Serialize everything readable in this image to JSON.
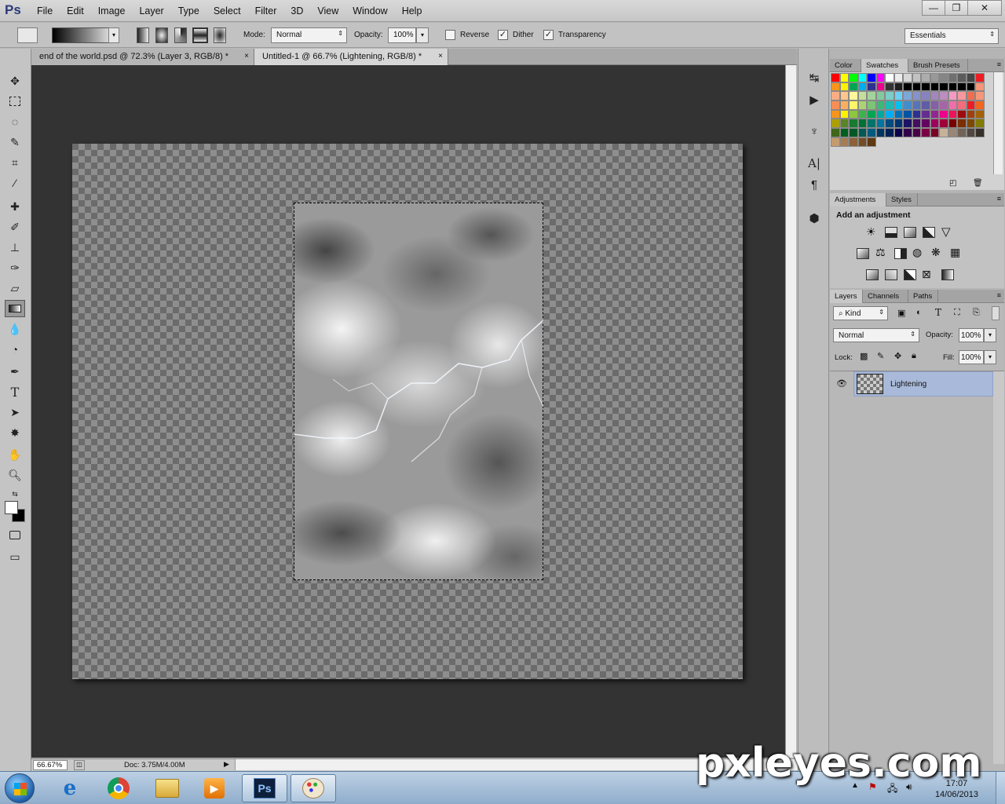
{
  "app": {
    "logo": "Ps"
  },
  "menu": [
    "File",
    "Edit",
    "Image",
    "Layer",
    "Type",
    "Select",
    "Filter",
    "3D",
    "View",
    "Window",
    "Help"
  ],
  "window_controls": {
    "minimize": "—",
    "restore": "❐",
    "close": "✕"
  },
  "options": {
    "mode_label": "Mode:",
    "mode_value": "Normal",
    "opacity_label": "Opacity:",
    "opacity_value": "100%",
    "reverse_label": "Reverse",
    "dither_label": "Dither",
    "transparency_label": "Transparency",
    "reverse_checked": false,
    "dither_checked": true,
    "transparency_checked": true,
    "workspace": "Essentials"
  },
  "doc_tabs": [
    {
      "label": "end of the world.psd @ 72.3% (Layer 3, RGB/8) *",
      "active": false
    },
    {
      "label": "Untitled-1 @ 66.7% (Lightening, RGB/8) *",
      "active": true
    }
  ],
  "status": {
    "zoom": "66.67%",
    "doc": "Doc: 3.75M/4.00M"
  },
  "panels": {
    "top_tabs": [
      "Color",
      "Swatches",
      "Brush Presets"
    ],
    "adj_tabs": [
      "Adjustments",
      "Styles"
    ],
    "adj_title": "Add an adjustment",
    "layer_tabs": [
      "Layers",
      "Channels",
      "Paths"
    ],
    "kind_label": "Kind",
    "blend_mode": "Normal",
    "opacity_label": "Opacity:",
    "opacity_value": "100%",
    "lock_label": "Lock:",
    "fill_label": "Fill:",
    "fill_value": "100%",
    "layers": [
      {
        "name": "Lightening",
        "visible": true,
        "selected": true
      }
    ]
  },
  "swatches": [
    "#ff0000",
    "#ffff00",
    "#00ff00",
    "#00ffff",
    "#0000ff",
    "#ff00ff",
    "#ffffff",
    "#ebebeb",
    "#d6d6d6",
    "#c2c2c2",
    "#adadad",
    "#999999",
    "#858585",
    "#707070",
    "#5c5c5c",
    "#474747",
    "#ee1d24",
    "#f7941d",
    "#fff200",
    "#00a651",
    "#00aeef",
    "#2e3192",
    "#ec008c",
    "#333333",
    "#1f1f1f",
    "#000000",
    "#000000",
    "#000000",
    "#000000",
    "#000000",
    "#000000",
    "#000000",
    "#000000",
    "#f69679",
    "#f9ad81",
    "#fdc68a",
    "#fff79a",
    "#c4df9b",
    "#a3d39c",
    "#82ca9d",
    "#7bcdc8",
    "#6ecff6",
    "#7ea7d8",
    "#8493ca",
    "#8882be",
    "#a187be",
    "#bc8dbf",
    "#f49ac2",
    "#f6989d",
    "#f26c4f",
    "#f7977a",
    "#f68e56",
    "#fbaf5d",
    "#fff568",
    "#acd373",
    "#7cc576",
    "#3cb878",
    "#1cbbb4",
    "#00bff3",
    "#448ccb",
    "#5674b9",
    "#605ca8",
    "#855fa8",
    "#a864a8",
    "#f06eaa",
    "#f26d7d",
    "#ed1c24",
    "#f26522",
    "#f7941d",
    "#fff200",
    "#8dc63f",
    "#39b54a",
    "#00a651",
    "#00a99d",
    "#00aeef",
    "#0072bc",
    "#0054a6",
    "#2e3192",
    "#662d91",
    "#92278f",
    "#ec008c",
    "#ed145b",
    "#9e0b0f",
    "#a0410d",
    "#a36209",
    "#aba000",
    "#598527",
    "#197b30",
    "#007236",
    "#00746b",
    "#0076a3",
    "#004b80",
    "#003471",
    "#1b1464",
    "#440e62",
    "#630460",
    "#9e005d",
    "#9e0039",
    "#790000",
    "#7b2e00",
    "#7d4900",
    "#827b00",
    "#406618",
    "#005e20",
    "#005826",
    "#005952",
    "#005b7f",
    "#003663",
    "#002157",
    "#0d004c",
    "#32004b",
    "#4b0049",
    "#7b0046",
    "#7a0026",
    "#c7b299",
    "#998675",
    "#736357",
    "#534741",
    "#37302a",
    "#c69c6d",
    "#a67c52",
    "#8c6239",
    "#754c24",
    "#603913"
  ],
  "taskbar": {
    "time": "17:07",
    "date": "14/06/2013"
  },
  "watermark": "pxleyes.com"
}
